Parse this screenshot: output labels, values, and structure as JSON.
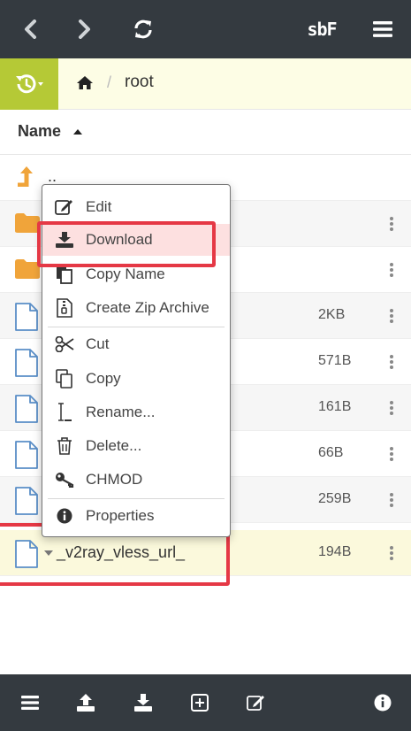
{
  "toolbar": {
    "brand": "sbF"
  },
  "breadcrumb": {
    "separator": "/",
    "current": "root"
  },
  "header": {
    "name_column": "Name"
  },
  "rows": [
    {
      "type": "parent",
      "name": "..",
      "size": ""
    },
    {
      "type": "folder",
      "name": "",
      "size": ""
    },
    {
      "type": "folder",
      "name": "",
      "size": ""
    },
    {
      "type": "file",
      "name": "",
      "size": "2KB"
    },
    {
      "type": "file",
      "name": "",
      "size": "571B"
    },
    {
      "type": "file",
      "name": "",
      "size": "161B"
    },
    {
      "type": "file",
      "name": "",
      "size": "66B"
    },
    {
      "type": "file",
      "name": "",
      "size": "259B"
    },
    {
      "type": "file",
      "name": "_v2ray_vless_url_",
      "size": "194B",
      "selected": true
    }
  ],
  "context_menu": {
    "items": [
      {
        "label": "Edit",
        "icon": "edit-icon"
      },
      {
        "label": "Download",
        "icon": "download-icon",
        "highlighted": true
      },
      {
        "label": "Copy Name",
        "icon": "copy-name-icon"
      },
      {
        "label": "Create Zip Archive",
        "icon": "zip-icon"
      },
      {
        "label": "Cut",
        "icon": "scissors-icon"
      },
      {
        "label": "Copy",
        "icon": "copy-icon"
      },
      {
        "label": "Rename...",
        "icon": "text-cursor-icon"
      },
      {
        "label": "Delete...",
        "icon": "trash-icon"
      },
      {
        "label": "CHMOD",
        "icon": "key-icon"
      },
      {
        "label": "Properties",
        "icon": "info-icon"
      }
    ]
  },
  "bottom_toolbar": {
    "icons": [
      "menu-icon",
      "upload-icon",
      "download-icon",
      "new-item-icon",
      "edit-icon",
      "info-icon"
    ]
  },
  "colors": {
    "toolbar_bg": "#343a40",
    "history_btn": "#b5c936",
    "folder": "#f0a43a",
    "file_outline": "#5a8ec7",
    "highlight": "#e53845"
  }
}
